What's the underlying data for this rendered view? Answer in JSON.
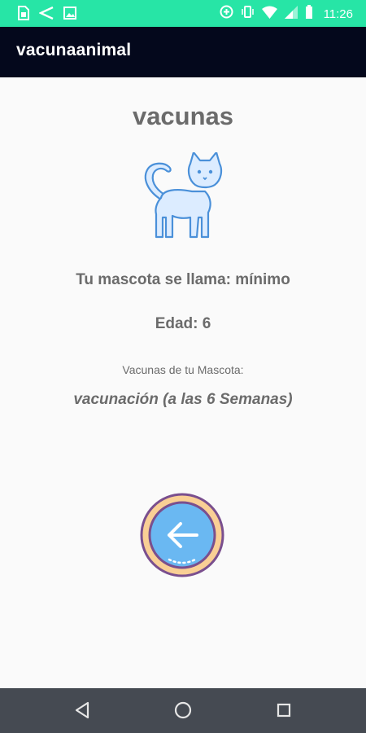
{
  "status_bar": {
    "time": "11:26",
    "left_icons": [
      "sim-icon",
      "share-icon",
      "image-icon"
    ],
    "right_icons": [
      "data-saver-icon",
      "vibrate-icon",
      "wifi-icon",
      "signal-icon",
      "battery-icon"
    ],
    "background": "#27e5a6"
  },
  "app_bar": {
    "title": "vacunaanimal",
    "background": "#04081c"
  },
  "main": {
    "heading": "vacunas",
    "pet_icon": "cat-icon",
    "pet_name_line": "Tu mascota se llama: mínimo",
    "age_line": "Edad: 6",
    "vaccines_label": "Vacunas de tu Mascota:",
    "vaccine_value": "vacunación (a las 6 Semanas)",
    "back_button_icon": "back-arrow-icon"
  },
  "nav_bar": {
    "buttons": [
      "back-triangle-icon",
      "home-circle-icon",
      "recents-square-icon"
    ],
    "background": "#454a52"
  }
}
